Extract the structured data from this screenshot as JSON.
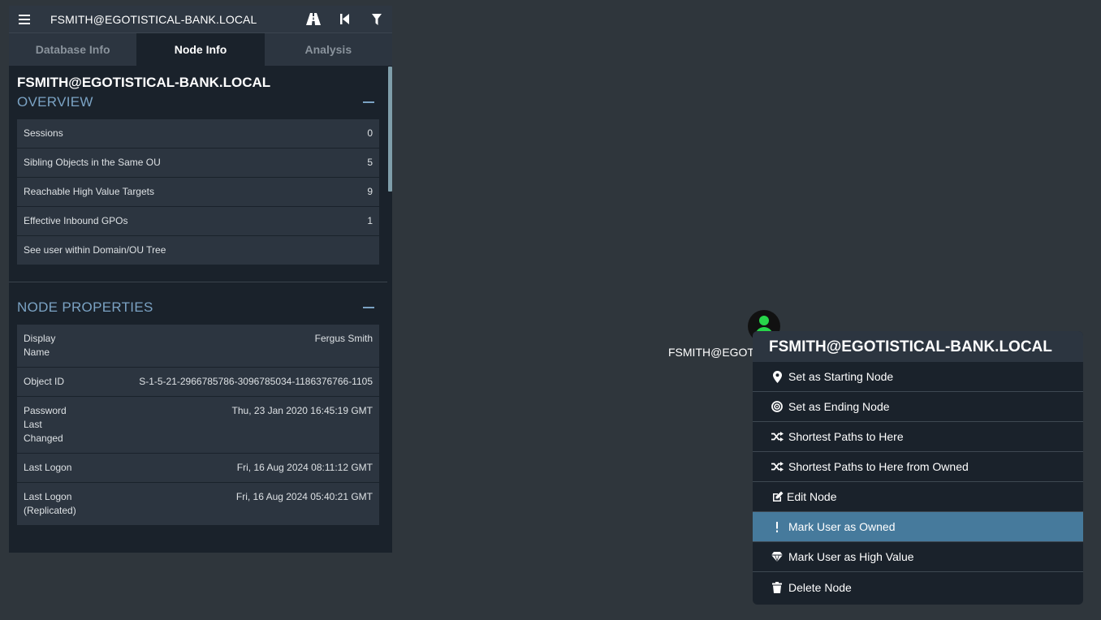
{
  "search": {
    "value": "FSMITH@EGOTISTICAL-BANK.LOCAL"
  },
  "tabs": [
    {
      "label": "Database Info"
    },
    {
      "label": "Node Info"
    },
    {
      "label": "Analysis"
    }
  ],
  "node": {
    "title": "FSMITH@EGOTISTICAL-BANK.LOCAL"
  },
  "overview": {
    "heading": "OVERVIEW",
    "rows": [
      {
        "label": "Sessions",
        "value": "0"
      },
      {
        "label": "Sibling Objects in the Same OU",
        "value": "5"
      },
      {
        "label": "Reachable High Value Targets",
        "value": "9"
      },
      {
        "label": "Effective Inbound GPOs",
        "value": "1"
      },
      {
        "label": "See user within Domain/OU Tree",
        "value": ""
      }
    ]
  },
  "properties": {
    "heading": "NODE PROPERTIES",
    "rows": [
      {
        "label": "Display Name",
        "value": "Fergus Smith"
      },
      {
        "label": "Object ID",
        "value": "S-1-5-21-2966785786-3096785034-1186376766-1105"
      },
      {
        "label": "Password Last Changed",
        "value": "Thu, 23 Jan 2020 16:45:19 GMT"
      },
      {
        "label": "Last Logon",
        "value": "Fri, 16 Aug 2024 08:11:12 GMT"
      },
      {
        "label": "Last Logon (Replicated)",
        "value": "Fri, 16 Aug 2024 05:40:21 GMT"
      }
    ]
  },
  "graph": {
    "node_label": "FSMITH@EGOTISTICAL-BANK.LOCAL",
    "node_color": "#27d64a"
  },
  "context_menu": {
    "title": "FSMITH@EGOTISTICAL-BANK.LOCAL",
    "items": [
      {
        "label": "Set as Starting Node",
        "icon": "map-marker-icon"
      },
      {
        "label": "Set as Ending Node",
        "icon": "bullseye-icon"
      },
      {
        "label": "Shortest Paths to Here",
        "icon": "random-icon"
      },
      {
        "label": "Shortest Paths to Here from Owned",
        "icon": "random-icon"
      },
      {
        "label": "Edit Node",
        "icon": "edit-icon"
      },
      {
        "label": "Mark User as Owned",
        "icon": "exclamation-icon",
        "selected": true
      },
      {
        "label": "Mark User as High Value",
        "icon": "gem-icon"
      },
      {
        "label": "Delete Node",
        "icon": "trash-icon"
      }
    ],
    "selected_color": "#467a9c"
  }
}
